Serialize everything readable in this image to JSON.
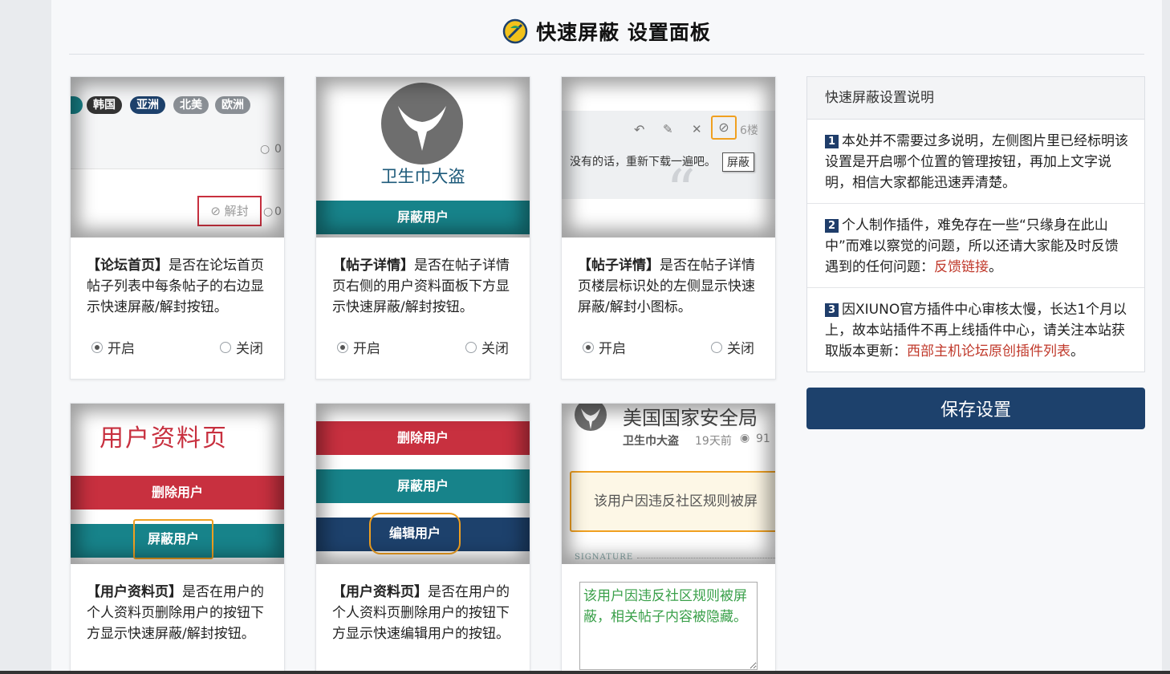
{
  "header": {
    "title": "快速屏蔽 设置面板"
  },
  "cards": [
    {
      "image": {
        "tags": [
          "韩国",
          "亚洲",
          "北美",
          "欧洲"
        ],
        "comment_count": "0",
        "unlock_label": "⊘ 解封"
      },
      "heading": "【论坛首页】",
      "text": "是否在论坛首页帖子列表中每条帖子的右边显示快速屏蔽/解封按钮。",
      "on_label": "开启",
      "off_label": "关闭",
      "selected": "on"
    },
    {
      "image": {
        "caption": "卫生巾大盗",
        "bar_label": "屏蔽用户"
      },
      "heading": "【帖子详情】",
      "text": "是否在帖子详情页右侧的用户资料面板下方显示快速屏蔽/解封按钮。",
      "on_label": "开启",
      "off_label": "关闭",
      "selected": "on"
    },
    {
      "image": {
        "floor": "6楼",
        "post_text": "没有的话，重新下载一遍吧。",
        "tooltip": "屏蔽"
      },
      "heading": "【帖子详情】",
      "text": "是否在帖子详情页楼层标识处的左侧显示快速屏蔽/解封小图标。",
      "on_label": "开启",
      "off_label": "关闭",
      "selected": "on"
    },
    {
      "image": {
        "page_title": "用户资料页",
        "delete_label": "删除用户",
        "block_label": "屏蔽用户"
      },
      "heading": "【用户资料页】",
      "text": "是否在用户的个人资料页删除用户的按钮下方显示快速屏蔽/解封按钮。"
    },
    {
      "image": {
        "delete_label": "删除用户",
        "block_label": "屏蔽用户",
        "edit_label": "编辑用户"
      },
      "heading": "【用户资料页】",
      "text": "是否在用户的个人资料页删除用户的按钮下方显示快速编辑用户的按钮。"
    },
    {
      "image": {
        "author_title": "美国国家安全局",
        "author": "卫生巾大盗",
        "time": "19天前",
        "views": "91",
        "notice": "该用户因违反社区规则被屏",
        "signature": "SIGNATURE"
      },
      "textarea_value": "该用户因违反社区规则被屏蔽，相关帖子内容被隐藏。"
    }
  ],
  "info": {
    "title": "快速屏蔽设置说明",
    "items": [
      {
        "num": "1",
        "text": "本处并不需要过多说明，左侧图片里已经标明该设置是开启哪个位置的管理按钮，再加上文字说明，相信大家都能迅速弄清楚。",
        "link": "",
        "tail": ""
      },
      {
        "num": "2",
        "text": "个人制作插件，难免存在一些“只缘身在此山中”而难以察觉的问题，所以还请大家能及时反馈遇到的任何问题：",
        "link": "反馈链接",
        "tail": "。"
      },
      {
        "num": "3",
        "text": "因XIUNO官方插件中心审核太慢，长达1个月以上，故本站插件不再上线插件中心，请关注本站获取版本更新：",
        "link": "西部主机论坛原创插件列表",
        "tail": "。"
      }
    ]
  },
  "save_label": "保存设置",
  "colors": {
    "primary": "#1d416c",
    "teal": "#17838a",
    "red": "#c8303f",
    "orange": "#f0a020",
    "link": "#c0392b",
    "green": "#3aa04a"
  }
}
